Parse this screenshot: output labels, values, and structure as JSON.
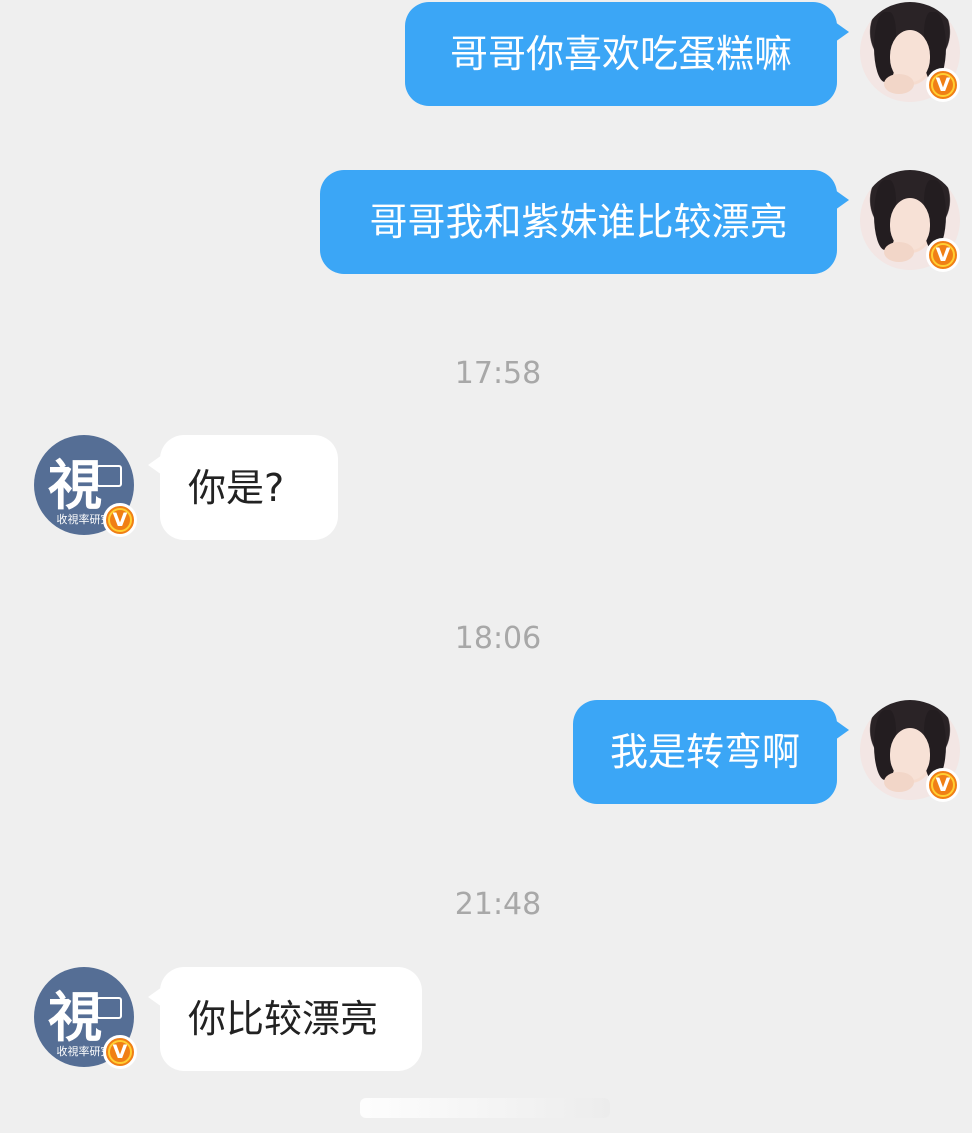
{
  "messages": [
    {
      "side": "out",
      "text": "哥哥你喜欢吃蛋糕嘛"
    },
    {
      "side": "out",
      "text": "哥哥我和紫妹谁比较漂亮"
    },
    {
      "side": "in",
      "text": "你是?"
    },
    {
      "side": "out",
      "text": "我是转弯啊"
    },
    {
      "side": "in",
      "text": "你比较漂亮"
    }
  ],
  "timestamps": [
    "17:58",
    "18:06",
    "21:48"
  ],
  "contact": {
    "avatar_glyph": "視",
    "avatar_caption": "收視率研究",
    "verified_badge": "V"
  },
  "me": {
    "verified_badge": "V"
  },
  "colors": {
    "background": "#efefef",
    "outgoing_bubble": "#3ba6f6",
    "incoming_bubble": "#ffffff",
    "timestamp": "#a8a8a8",
    "badge": "#f07f15"
  }
}
